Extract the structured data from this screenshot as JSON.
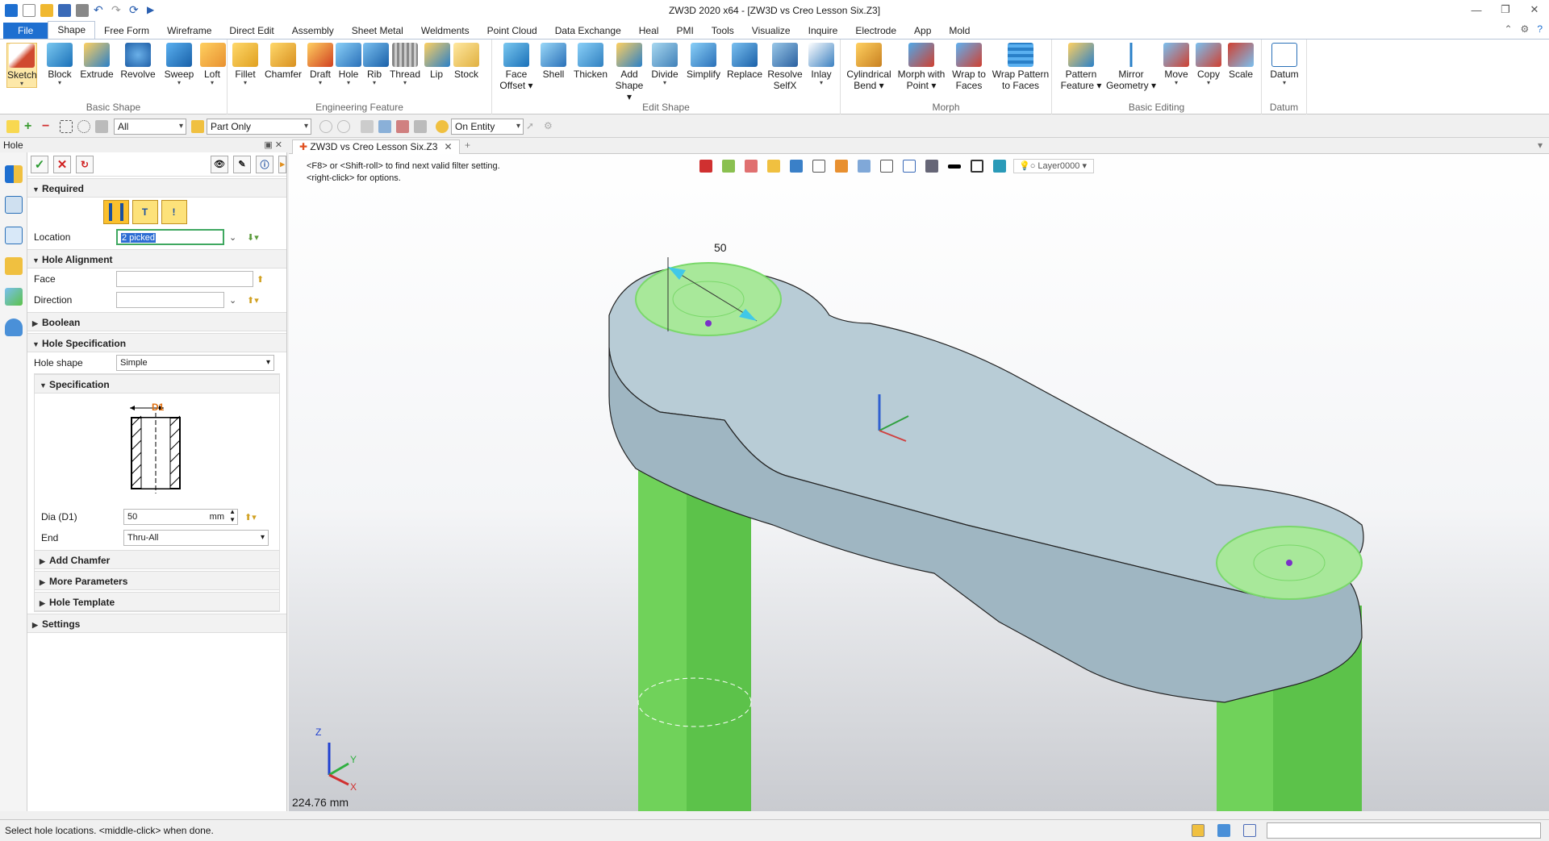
{
  "window": {
    "title": "ZW3D 2020 x64 - [ZW3D vs Creo Lesson Six.Z3]"
  },
  "menu": {
    "file": "File",
    "tabs": [
      "Shape",
      "Free Form",
      "Wireframe",
      "Direct Edit",
      "Assembly",
      "Sheet Metal",
      "Weldments",
      "Point Cloud",
      "Data Exchange",
      "Heal",
      "PMI",
      "Tools",
      "Visualize",
      "Inquire",
      "Electrode",
      "App",
      "Mold"
    ]
  },
  "ribbon": {
    "groups": {
      "basic_shape": "Basic Shape",
      "engineering_feature": "Engineering Feature",
      "edit_shape": "Edit Shape",
      "morph": "Morph",
      "basic_editing": "Basic Editing",
      "datum": "Datum"
    },
    "buttons": {
      "sketch": "Sketch",
      "block": "Block",
      "extrude": "Extrude",
      "revolve": "Revolve",
      "sweep": "Sweep",
      "loft": "Loft",
      "fillet": "Fillet",
      "chamfer": "Chamfer",
      "draft": "Draft",
      "hole": "Hole",
      "rib": "Rib",
      "thread": "Thread",
      "lip": "Lip",
      "stock": "Stock",
      "face_offset_1": "Face",
      "face_offset_2": "Offset",
      "shell": "Shell",
      "thicken": "Thicken",
      "add_shape_1": "Add",
      "add_shape_2": "Shape",
      "divide": "Divide",
      "simplify": "Simplify",
      "replace": "Replace",
      "resolve_1": "Resolve",
      "resolve_2": "SelfX",
      "inlay": "Inlay",
      "cyl_bend_1": "Cylindrical",
      "cyl_bend_2": "Bend",
      "morph_point_1": "Morph with",
      "morph_point_2": "Point",
      "wrap_1": "Wrap to",
      "wrap_2": "Faces",
      "wrap_pattern_1": "Wrap Pattern",
      "wrap_pattern_2": "to Faces",
      "pattern_1": "Pattern",
      "pattern_2": "Feature",
      "mirror_1": "Mirror",
      "mirror_2": "Geometry",
      "move": "Move",
      "copy": "Copy",
      "scale": "Scale",
      "datum": "Datum"
    }
  },
  "toolbar2": {
    "filter": "All",
    "scope": "Part Only",
    "pick": "On Entity"
  },
  "panel": {
    "title": "Hole",
    "required": "Required",
    "location_label": "Location",
    "location_value": "2 picked",
    "hole_alignment": "Hole Alignment",
    "face_label": "Face",
    "direction_label": "Direction",
    "boolean": "Boolean",
    "hole_specification": "Hole Specification",
    "hole_shape_label": "Hole shape",
    "hole_shape_value": "Simple",
    "specification": "Specification",
    "d1_label": "D1",
    "dia_label": "Dia (D1)",
    "dia_value": "50",
    "dia_unit": "mm",
    "end_label": "End",
    "end_value": "Thru-All",
    "add_chamfer": "Add Chamfer",
    "more_parameters": "More Parameters",
    "hole_template": "Hole Template",
    "settings": "Settings"
  },
  "viewport": {
    "tab": "ZW3D vs Creo Lesson Six.Z3",
    "hint1": "<F8> or <Shift-roll> to find next valid filter setting.",
    "hint2": "<right-click> for options.",
    "layer": "Layer0000",
    "dimension": "50",
    "scale_text": "224.76 mm",
    "axes": {
      "x": "X",
      "y": "Y",
      "z": "Z"
    }
  },
  "status": {
    "message": "Select hole locations. <middle-click> when done."
  },
  "colors": {
    "accent": "#1e6fd0",
    "green_solid": "#5cc24a",
    "part_face": "#b8ccd6",
    "hole_face": "#a8e89a"
  }
}
